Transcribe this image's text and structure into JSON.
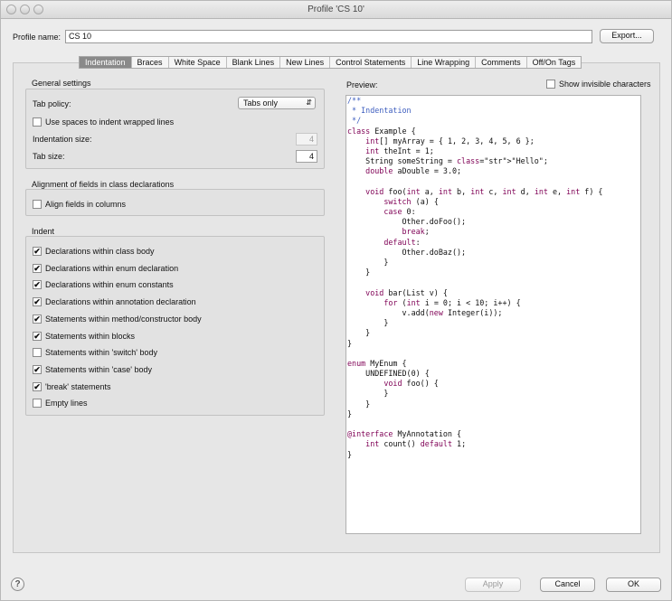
{
  "window": {
    "title": "Profile 'CS 10'"
  },
  "profile": {
    "label": "Profile name:",
    "value": "CS 10",
    "export_label": "Export..."
  },
  "tabs": [
    {
      "label": "Indentation",
      "active": true
    },
    {
      "label": "Braces",
      "active": false
    },
    {
      "label": "White Space",
      "active": false
    },
    {
      "label": "Blank Lines",
      "active": false
    },
    {
      "label": "New Lines",
      "active": false
    },
    {
      "label": "Control Statements",
      "active": false
    },
    {
      "label": "Line Wrapping",
      "active": false
    },
    {
      "label": "Comments",
      "active": false
    },
    {
      "label": "Off/On Tags",
      "active": false
    }
  ],
  "general": {
    "title": "General settings",
    "tab_policy_label": "Tab policy:",
    "tab_policy_value": "Tabs only",
    "spaces_wrapped_label": "Use spaces to indent wrapped lines",
    "spaces_wrapped_checked": false,
    "indent_size_label": "Indentation size:",
    "indent_size_value": "4",
    "tab_size_label": "Tab size:",
    "tab_size_value": "4"
  },
  "alignment": {
    "title": "Alignment of fields in class declarations",
    "align_label": "Align fields in columns",
    "align_checked": false
  },
  "indent": {
    "title": "Indent",
    "items": [
      {
        "label": "Declarations within class body",
        "checked": true
      },
      {
        "label": "Declarations within enum declaration",
        "checked": true
      },
      {
        "label": "Declarations within enum constants",
        "checked": true
      },
      {
        "label": "Declarations within annotation declaration",
        "checked": true
      },
      {
        "label": "Statements within method/constructor body",
        "checked": true
      },
      {
        "label": "Statements within blocks",
        "checked": true
      },
      {
        "label": "Statements within 'switch' body",
        "checked": false
      },
      {
        "label": "Statements within 'case' body",
        "checked": true
      },
      {
        "label": "'break' statements",
        "checked": true
      },
      {
        "label": "Empty lines",
        "checked": false
      }
    ]
  },
  "preview": {
    "label": "Preview:",
    "show_invisible_label": "Show invisible characters",
    "show_invisible_checked": false,
    "lines": [
      "/**",
      " * Indentation",
      " */",
      "class Example {",
      "    int[] myArray = { 1, 2, 3, 4, 5, 6 };",
      "    int theInt = 1;",
      "    String someString = \"Hello\";",
      "    double aDouble = 3.0;",
      "",
      "    void foo(int a, int b, int c, int d, int e, int f) {",
      "        switch (a) {",
      "        case 0:",
      "            Other.doFoo();",
      "            break;",
      "        default:",
      "            Other.doBaz();",
      "        }",
      "    }",
      "",
      "    void bar(List v) {",
      "        for (int i = 0; i < 10; i++) {",
      "            v.add(new Integer(i));",
      "        }",
      "    }",
      "}",
      "",
      "enum MyEnum {",
      "    UNDEFINED(0) {",
      "        void foo() {",
      "        }",
      "    }",
      "}",
      "",
      "@interface MyAnnotation {",
      "    int count() default 1;",
      "}"
    ]
  },
  "footer": {
    "help_label": "?",
    "apply_label": "Apply",
    "cancel_label": "Cancel",
    "ok_label": "OK"
  }
}
